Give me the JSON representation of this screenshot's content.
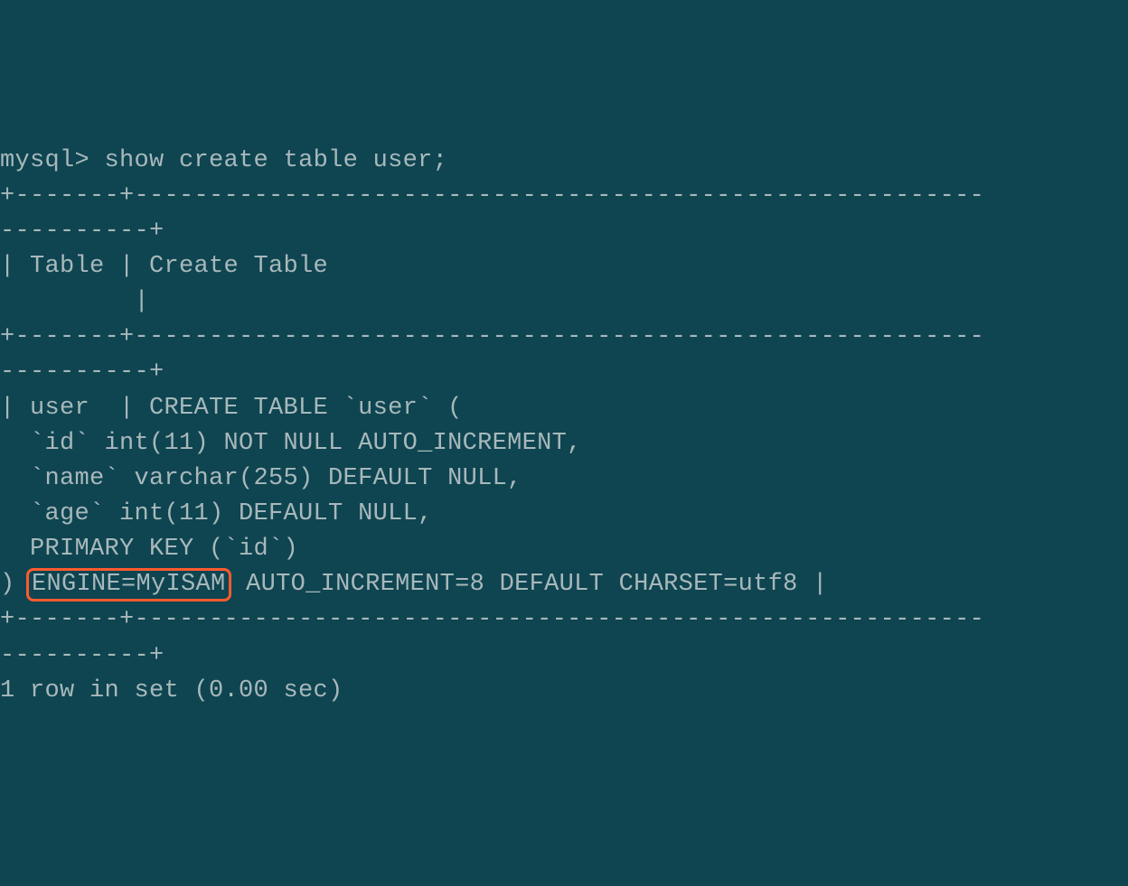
{
  "terminal": {
    "prompt": "mysql> ",
    "command": "show create table user;",
    "sep1a": "+-------+---------------------------------------------------------",
    "sep1b": "----------+",
    "header": "| Table | Create Table",
    "header_cont": "         |",
    "sep2a": "+-------+---------------------------------------------------------",
    "sep2b": "----------+",
    "row_start": "| user  | CREATE TABLE `user` (",
    "row_l2": "  `id` int(11) NOT NULL AUTO_INCREMENT,",
    "row_l3": "  `name` varchar(255) DEFAULT NULL,",
    "row_l4": "  `age` int(11) DEFAULT NULL,",
    "row_l5": "  PRIMARY KEY (`id`)",
    "row_l6_prefix": ") ",
    "row_l6_highlight": "ENGINE=MyISAM",
    "row_l6_suffix": " AUTO_INCREMENT=8 DEFAULT CHARSET=utf8 |",
    "sep3a": "+-------+---------------------------------------------------------",
    "sep3b": "----------+",
    "footer": "1 row in set (0.00 sec)"
  }
}
